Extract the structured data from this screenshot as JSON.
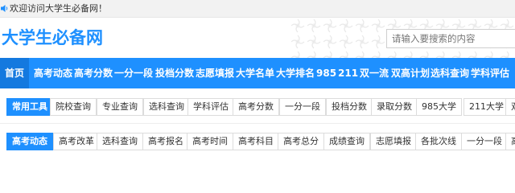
{
  "topbar": {
    "welcome": "欢迎访问大学生必备网！"
  },
  "header": {
    "logo": "大学生必备网",
    "search_placeholder": "请输入要搜索的内容"
  },
  "nav": {
    "items": [
      "首页",
      "高考动态",
      "高考分数",
      "一分一段",
      "投档分数",
      "志愿填报",
      "大学名单",
      "大学排名",
      "985",
      "211",
      "双一流",
      "双高计划",
      "选科查询",
      "学科评估"
    ]
  },
  "tools_row": {
    "label": "常用工具",
    "items": [
      "院校查询",
      "专业查询",
      "选科查询",
      "学科评估",
      "高考分数",
      "一分一段",
      "投档分数",
      "录取分数",
      "985大学",
      "211大学",
      "双"
    ]
  },
  "news_row": {
    "label": "高考动态",
    "items": [
      "高考改革",
      "选科查询",
      "高考报名",
      "高考时间",
      "高考科目",
      "高考总分",
      "成绩查询",
      "志愿填报",
      "各批次线",
      "一分一段",
      "高"
    ]
  },
  "colors": {
    "accent": "#1e90ff",
    "accent_dark": "#1479df",
    "topbar_bg": "#f2f2f2",
    "chip_border": "#dcdcdc"
  }
}
